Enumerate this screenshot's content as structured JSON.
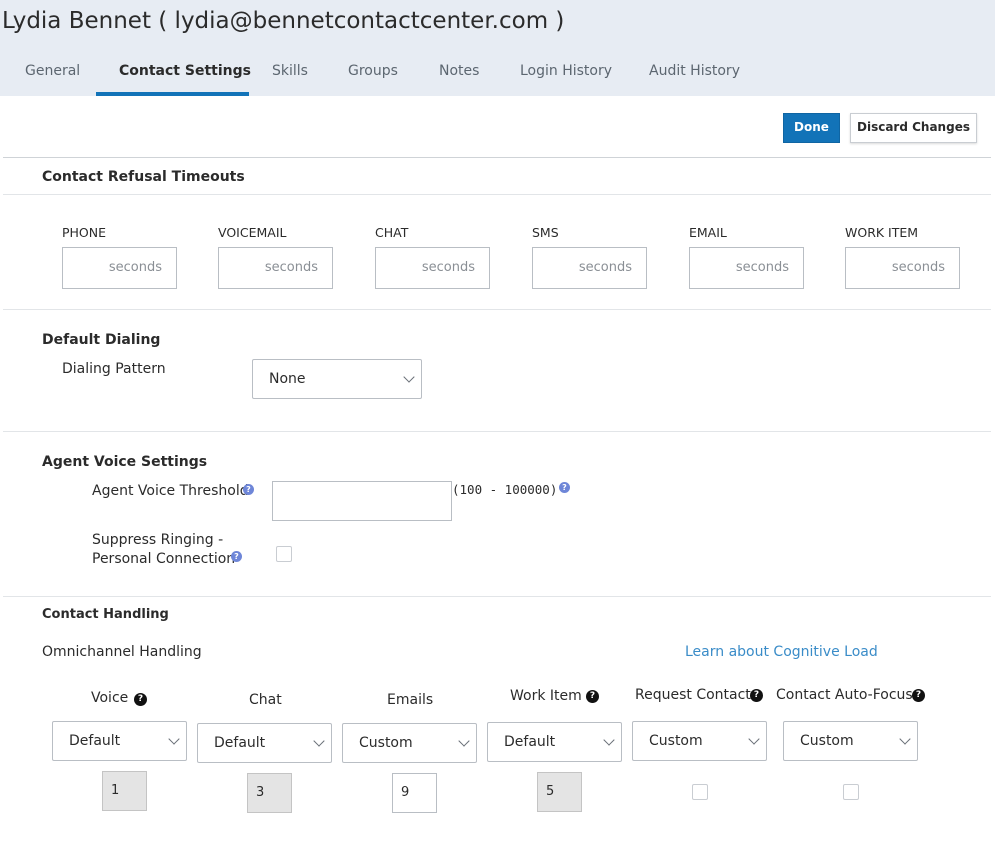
{
  "header": {
    "title": "Lydia Bennet ( lydia@bennetcontactcenter.com )",
    "tabs": [
      "General",
      "Contact Settings",
      "Skills",
      "Groups",
      "Notes",
      "Login History",
      "Audit History"
    ],
    "active_tab": "Contact Settings"
  },
  "actions": {
    "done": "Done",
    "discard": "Discard Changes"
  },
  "refusal": {
    "title": "Contact Refusal Timeouts",
    "channels": [
      "PHONE",
      "VOICEMAIL",
      "CHAT",
      "SMS",
      "EMAIL",
      "WORK ITEM"
    ],
    "placeholder": "seconds"
  },
  "dialing": {
    "title": "Default Dialing",
    "pattern_label": "Dialing Pattern",
    "pattern_value": "None"
  },
  "voice": {
    "title": "Agent Voice Settings",
    "threshold_label": "Agent Voice Threshold",
    "threshold_value": "",
    "range": "(100 - 100000)",
    "suppress_line1": "Suppress Ringing -",
    "suppress_line2": "Personal Connection",
    "suppress_checked": false
  },
  "handling": {
    "title": "Contact Handling",
    "omni_label": "Omnichannel Handling",
    "learn_link": "Learn about Cognitive Load",
    "columns": [
      {
        "label": "Voice",
        "help": true,
        "select": "Default",
        "number": "1",
        "editable": false
      },
      {
        "label": "Chat",
        "help": false,
        "select": "Default",
        "number": "3",
        "editable": false
      },
      {
        "label": "Emails",
        "help": false,
        "select": "Custom",
        "number": "9",
        "editable": true
      },
      {
        "label": "Work Item",
        "help": true,
        "select": "Default",
        "number": "5",
        "editable": false
      },
      {
        "label": "Request Contact",
        "help": true,
        "select": "Custom",
        "checkbox": false
      },
      {
        "label": "Contact Auto-Focus",
        "help": true,
        "select": "Custom",
        "checkbox": false
      }
    ]
  },
  "icons": {
    "info": "info-circle-icon",
    "help": "question-circle-icon",
    "chevron": "chevron-down-icon"
  },
  "colors": {
    "accent": "#1273b8",
    "header_bg": "#e7ecf3",
    "link": "#3a8cc8"
  }
}
